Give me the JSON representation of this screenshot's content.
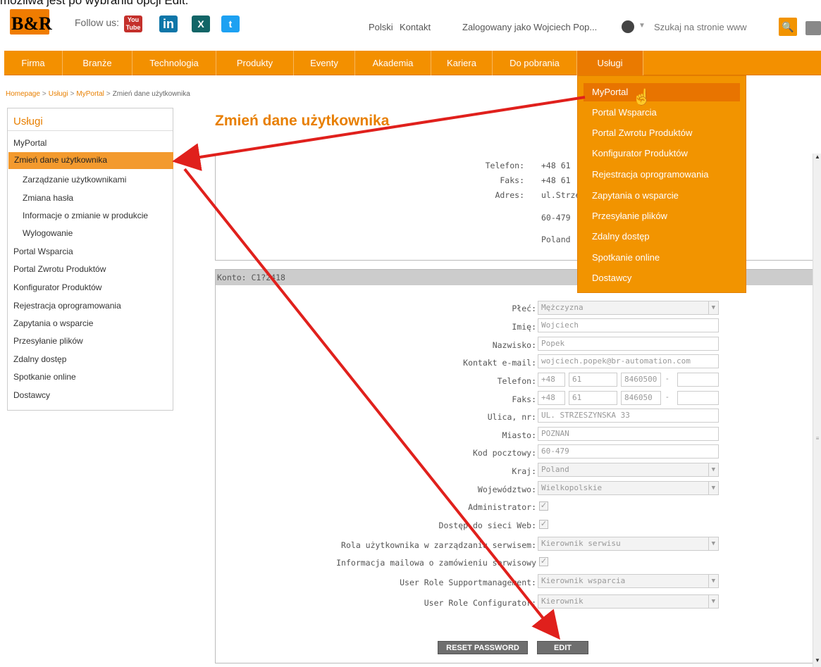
{
  "caption": "możliwa jest po wybraniu opcji Edit.",
  "header": {
    "logo_text": "B&R",
    "follow_label": "Follow us:",
    "social": [
      {
        "name": "youtube-icon",
        "text": "You Tube"
      },
      {
        "name": "linkedin-icon",
        "text": "in"
      },
      {
        "name": "xing-icon",
        "text": "X"
      },
      {
        "name": "twitter-icon",
        "text": "t"
      }
    ],
    "links": {
      "polski": "Polski",
      "kontakt": "Kontakt",
      "login": "Zalogowany jako Wojciech Pop..."
    },
    "search": {
      "placeholder": "Szukaj na stronie www",
      "button": "🔍"
    }
  },
  "nav": {
    "items": [
      "Firma",
      "Branże",
      "Technologia",
      "Produkty",
      "Eventy",
      "Akademia",
      "Kariera",
      "Do pobrania",
      "Usługi"
    ],
    "active_index": 8
  },
  "breadcrumb": {
    "items": [
      "Homepage",
      "Usługi",
      "MyPortal",
      "Zmień dane użytkownika"
    ],
    "separator": ">"
  },
  "sidebar": {
    "title": "Usługi",
    "section": "MyPortal",
    "sub_items": [
      "Zmień dane użytkownika",
      "Zarządzanie użytkownikami",
      "Zmiana hasła",
      "Informacje o zmianie w produkcie",
      "Wylogowanie"
    ],
    "items": [
      "Portal Wsparcia",
      "Portal Zwrotu Produktów",
      "Konfigurator Produktów",
      "Rejestracja oprogramowania",
      "Zapytania o wsparcie",
      "Przesyłanie plików",
      "Zdalny dostęp",
      "Spotkanie online",
      "Dostawcy"
    ]
  },
  "page_title": "Zmień dane użytkownika",
  "upper_panel": {
    "telefon_label": "Telefon:",
    "telefon_value": "+48 61",
    "faks_label": "Faks:",
    "faks_value": "+48 61",
    "adres_label": "Adres:",
    "adres_value": "ul.Strze",
    "postal": "60-479",
    "country": "Poland"
  },
  "account": {
    "header": "Konto: C1?2418",
    "fields": {
      "plec": {
        "label": "Płeć:",
        "value": "Mężczyzna"
      },
      "imie": {
        "label": "Imię:",
        "value": "Wojciech"
      },
      "nazwisko": {
        "label": "Nazwisko:",
        "value": "Popek"
      },
      "email": {
        "label": "Kontakt e-mail:",
        "value": "wojciech.popek@br-automation.com"
      },
      "telefon": {
        "label": "Telefon:",
        "cc": "+48",
        "area": "61",
        "num": "8460500",
        "ext": ""
      },
      "faks": {
        "label": "Faks:",
        "cc": "+48",
        "area": "61",
        "num": "846050",
        "ext": ""
      },
      "ulica": {
        "label": "Ulica, nr:",
        "value": "UL. STRZESZYNSKA 33"
      },
      "miasto": {
        "label": "Miasto:",
        "value": "POZNAN"
      },
      "kod": {
        "label": "Kod pocztowy:",
        "value": "60-479"
      },
      "kraj": {
        "label": "Kraj:",
        "value": "Poland"
      },
      "wojewodztwo": {
        "label": "Województwo:",
        "value": "Wielkopolskie"
      },
      "administrator": {
        "label": "Administrator:",
        "checked": "✓"
      },
      "dostep": {
        "label": "Dostęp do sieci Web:",
        "checked": "✓"
      },
      "rola": {
        "label": "Rola użytkownika w zarządzaniu serwisem:",
        "value": "Kierownik serwisu"
      },
      "informacja": {
        "label": "Informacja mailowa o zamówieniu serwisowy",
        "checked": "✓"
      },
      "support": {
        "label": "User Role Supportmanagement:",
        "value": "Kierownik wsparcia"
      },
      "configurator": {
        "label": "User Role Configurator:",
        "value": "Kierownik"
      }
    },
    "buttons": {
      "reset": "RESET PASSWORD",
      "edit": "EDIT"
    },
    "caret": "▼",
    "dash": "-"
  },
  "dropdown": {
    "items": [
      "MyPortal",
      "Portal Wsparcia",
      "Portal Zwrotu Produktów",
      "Konfigurator Produktów",
      "Rejestracja oprogramowania",
      "Zapytania o wsparcie",
      "Przesyłanie plików",
      "Zdalny dostęp",
      "Spotkanie online",
      "Dostawcy"
    ],
    "highlighted_index": 0
  },
  "colors": {
    "accent": "#f39000",
    "arrow": "#e0201c"
  }
}
